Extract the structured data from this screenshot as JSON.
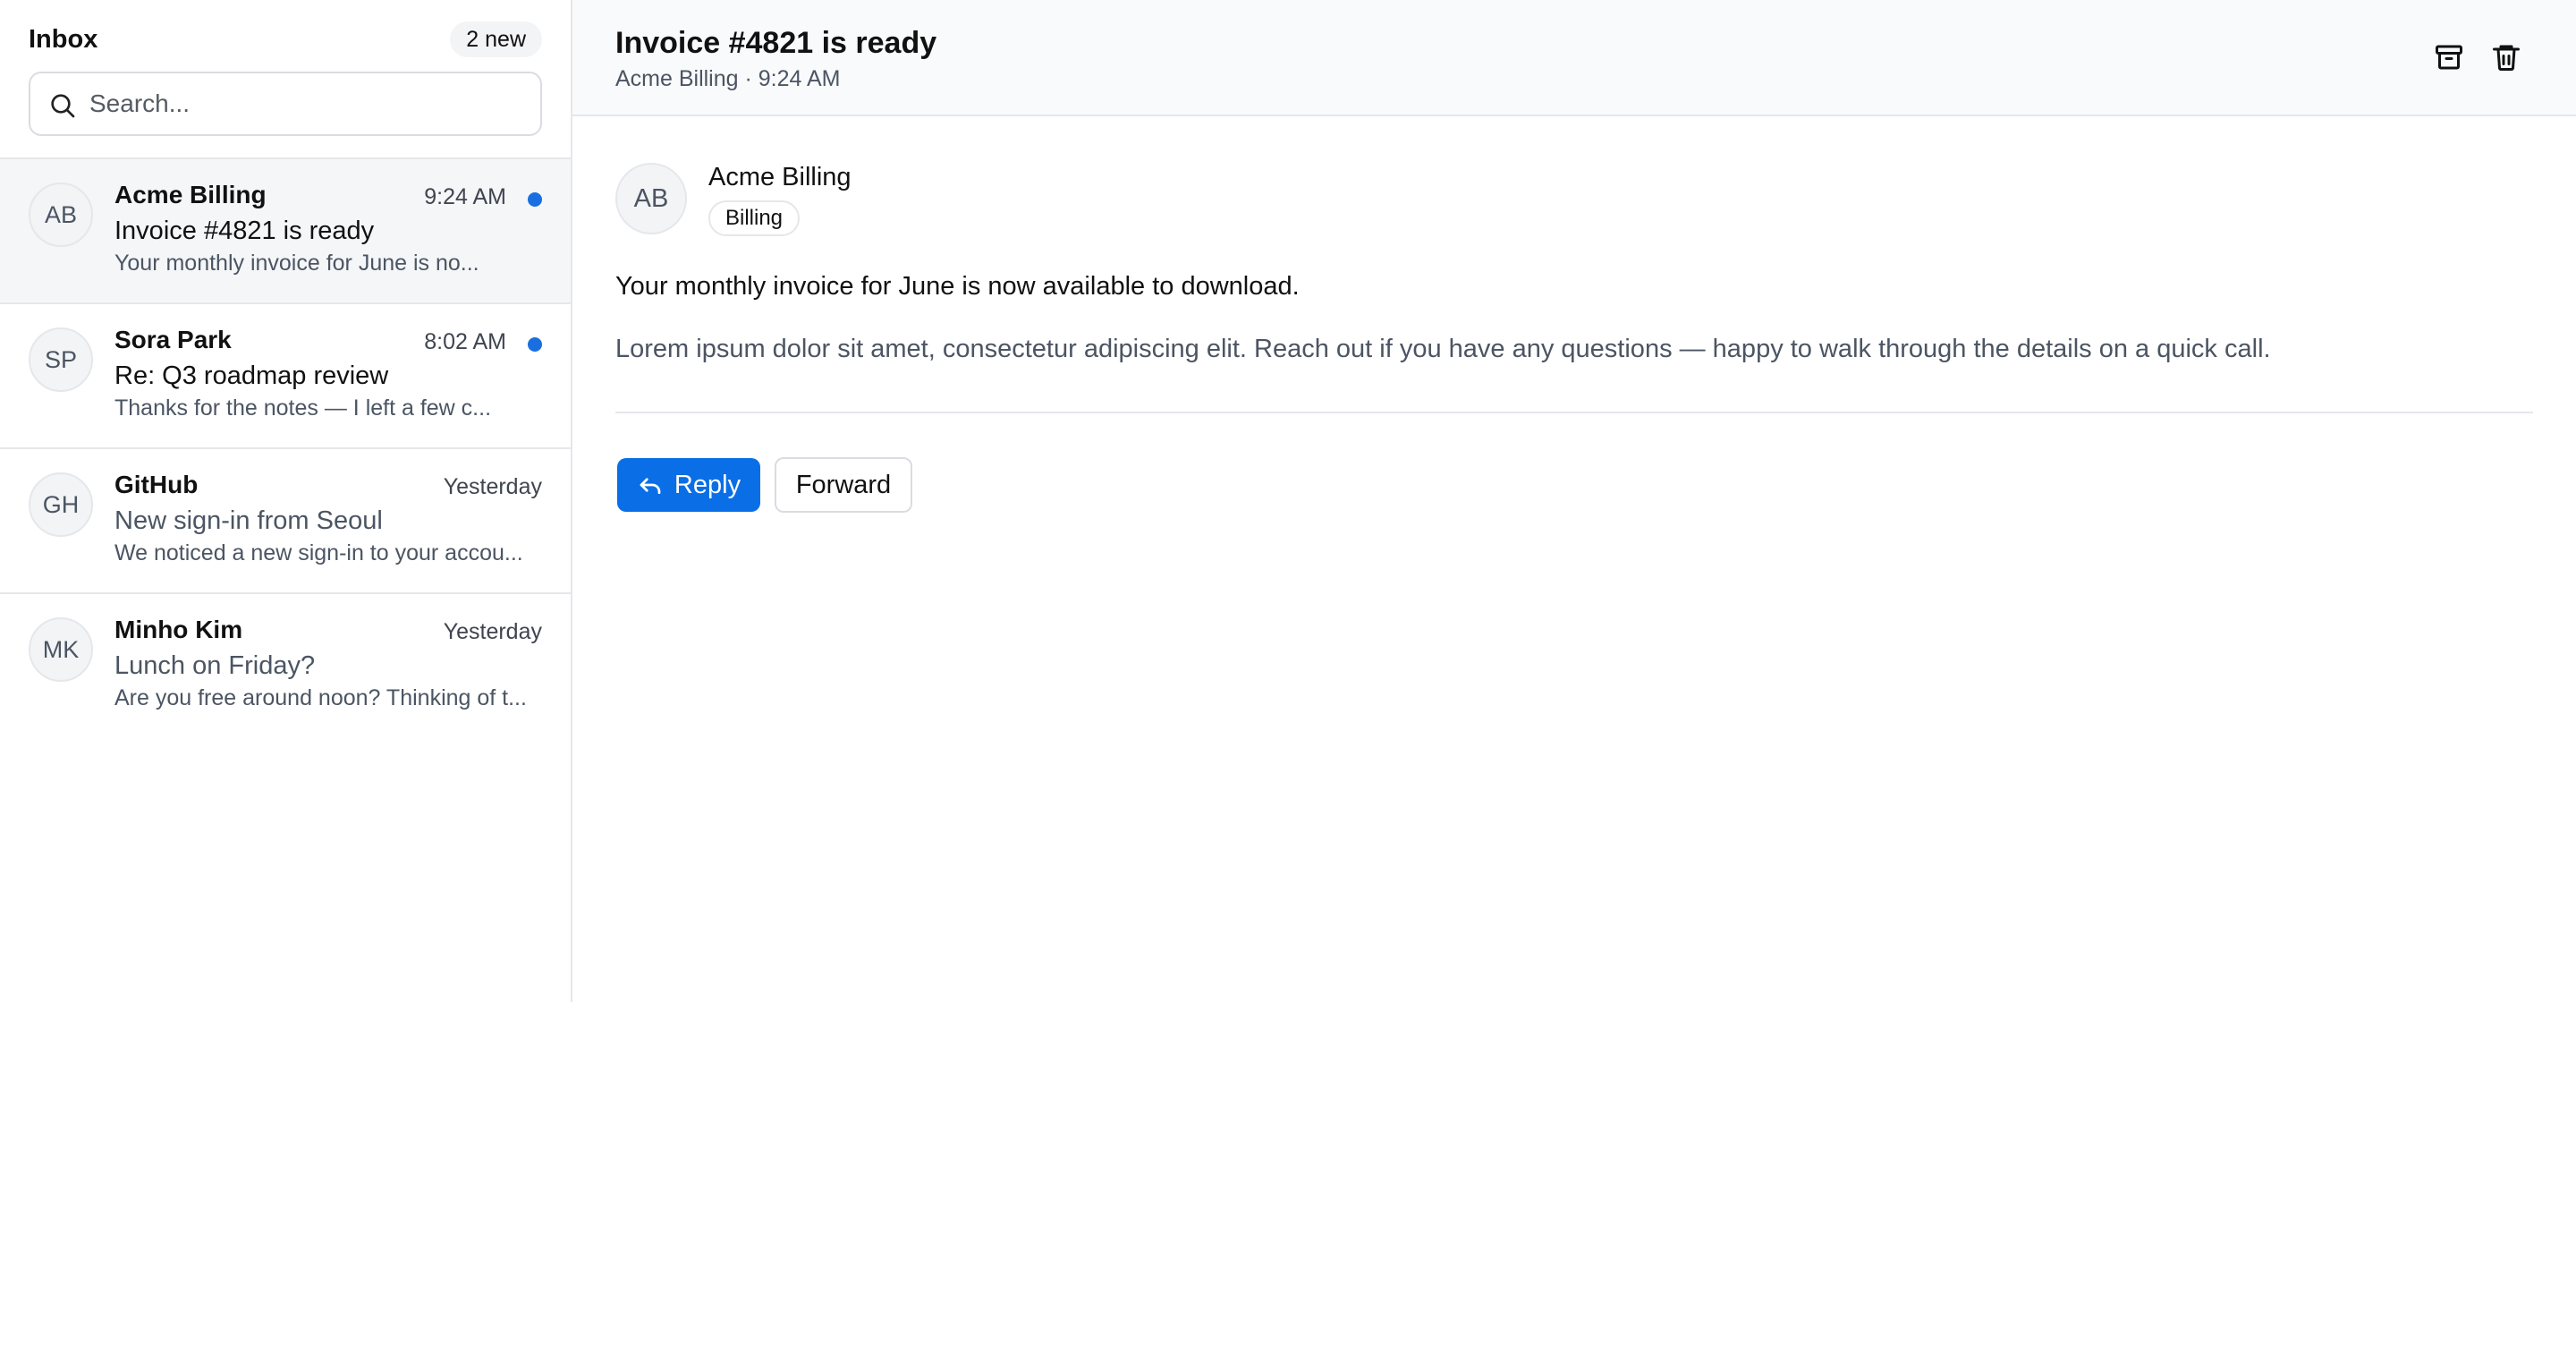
{
  "sidebar": {
    "title": "Inbox",
    "badge": "2 new",
    "search": {
      "placeholder": "Search...",
      "value": ""
    },
    "items": [
      {
        "initials": "AB",
        "sender": "Acme Billing",
        "time": "9:24 AM",
        "subject": "Invoice #4821 is ready",
        "preview": "Your monthly invoice for June is no...",
        "unread": true,
        "selected": true
      },
      {
        "initials": "SP",
        "sender": "Sora Park",
        "time": "8:02 AM",
        "subject": "Re: Q3 roadmap review",
        "preview": "Thanks for the notes — I left a few c...",
        "unread": true,
        "selected": false
      },
      {
        "initials": "GH",
        "sender": "GitHub",
        "time": "Yesterday",
        "subject": "New sign-in from Seoul",
        "preview": "We noticed a new sign-in to your accou...",
        "unread": false,
        "selected": false
      },
      {
        "initials": "MK",
        "sender": "Minho Kim",
        "time": "Yesterday",
        "subject": "Lunch on Friday?",
        "preview": "Are you free around noon? Thinking of t...",
        "unread": false,
        "selected": false
      }
    ]
  },
  "message": {
    "title": "Invoice #4821 is ready",
    "meta": "Acme Billing · 9:24 AM",
    "sender_initials": "AB",
    "sender_name": "Acme Billing",
    "tag": "Billing",
    "body_main": "Your monthly invoice for June is now available to download.",
    "body_secondary": "Lorem ipsum dolor sit amet, consectetur adipiscing elit. Reach out if you have any questions — happy to walk through the details on a quick call.",
    "actions": {
      "reply_label": "Reply",
      "forward_label": "Forward"
    }
  },
  "icons": {
    "search": "search-icon",
    "archive": "archive-icon",
    "trash": "trash-icon",
    "reply": "reply-arrow-icon"
  },
  "colors": {
    "accent": "#0a6ee6",
    "unread_dot": "#1a6fe0",
    "selected_row": "#f5f6f8",
    "header_bg": "#f9fafb",
    "border": "#e5e7eb"
  }
}
